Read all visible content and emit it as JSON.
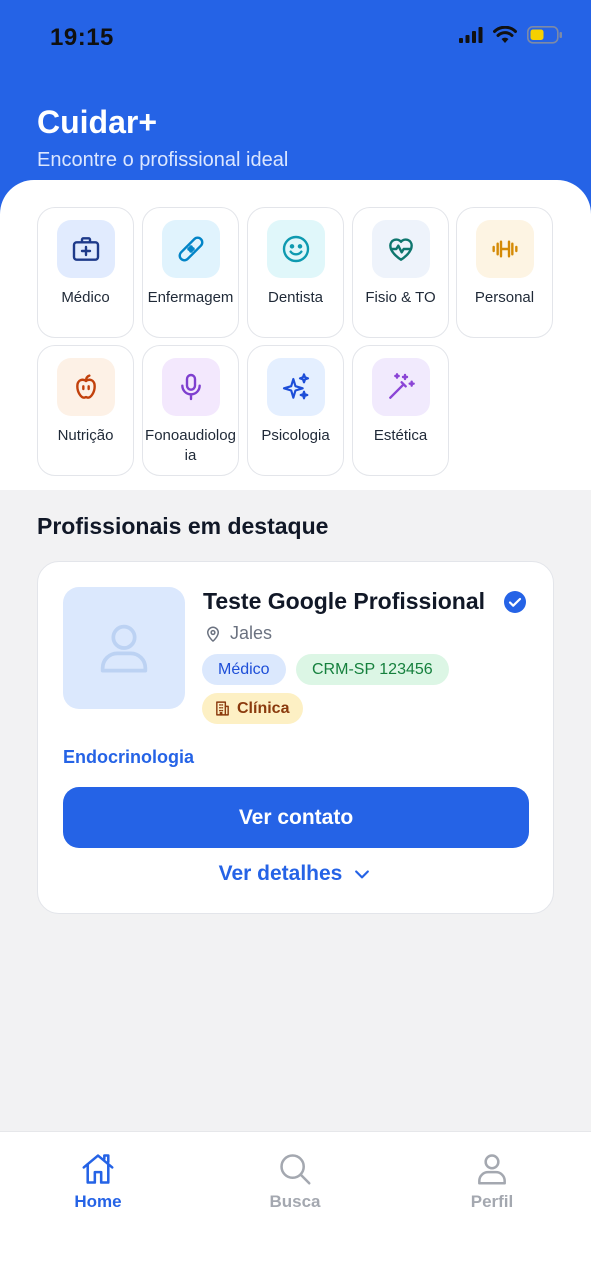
{
  "status_bar": {
    "time": "19:15"
  },
  "header": {
    "title": "Cuidar+",
    "subtitle": "Encontre o profissional ideal"
  },
  "categories": [
    {
      "label": "Médico",
      "icon": "medical-kit-icon",
      "bg": "#e1ebfe",
      "color": "#1e3a8a"
    },
    {
      "label": "Enfermagem",
      "icon": "bandage-icon",
      "bg": "#e0f3fd",
      "color": "#0284c7"
    },
    {
      "label": "Dentista",
      "icon": "smile-icon",
      "bg": "#e0f7fa",
      "color": "#0e9ab0"
    },
    {
      "label": "Fisio & TO",
      "icon": "heart-pulse-icon",
      "bg": "#eef3fb",
      "color": "#0f766e"
    },
    {
      "label": "Personal",
      "icon": "dumbbell-icon",
      "bg": "#fdf4e3",
      "color": "#d48a06"
    },
    {
      "label": "Nutrição",
      "icon": "apple-icon",
      "bg": "#fdf1e6",
      "color": "#c2410c"
    },
    {
      "label": "Fonoaudiologia",
      "icon": "microphone-icon",
      "bg": "#f3e8fd",
      "color": "#7e3fcf"
    },
    {
      "label": "Psicologia",
      "icon": "sparkles-icon",
      "bg": "#e4efff",
      "color": "#1d4ed8"
    },
    {
      "label": "Estética",
      "icon": "magic-wand-icon",
      "bg": "#f1eafd",
      "color": "#8b45d6"
    }
  ],
  "featured": {
    "section_title": "Profissionais em destaque",
    "name": "Teste Google Profissional",
    "location": "Jales",
    "tags": {
      "type": "Médico",
      "registry": "CRM-SP 123456",
      "place": "Clínica"
    },
    "specialty": "Endocrinologia",
    "contact_label": "Ver contato",
    "details_label": "Ver detalhes"
  },
  "tabbar": {
    "home": "Home",
    "search": "Busca",
    "profile": "Perfil"
  },
  "colors": {
    "accent": "#2563e6",
    "background": "#f2f2f3"
  }
}
